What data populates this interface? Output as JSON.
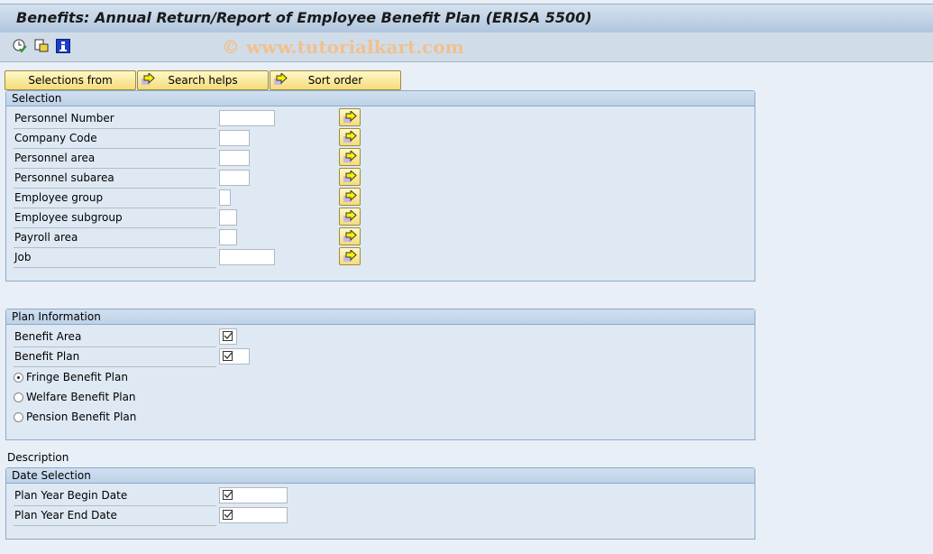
{
  "window": {
    "title": "Benefits: Annual Return/Report of Employee Benefit Plan (ERISA 5500)",
    "watermark": "© www.tutorialkart.com"
  },
  "toolbar": {
    "icons": [
      "execute-clock-icon",
      "get-variant-icon",
      "info-icon"
    ]
  },
  "buttons": {
    "selections_from": "Selections from",
    "search_helps": "Search helps",
    "sort_order": "Sort order"
  },
  "selection": {
    "title": "Selection",
    "fields": [
      {
        "label": "Personnel Number",
        "value": ""
      },
      {
        "label": "Company Code",
        "value": ""
      },
      {
        "label": "Personnel area",
        "value": ""
      },
      {
        "label": "Personnel subarea",
        "value": ""
      },
      {
        "label": "Employee group",
        "value": ""
      },
      {
        "label": "Employee subgroup",
        "value": ""
      },
      {
        "label": "Payroll area",
        "value": ""
      },
      {
        "label": "Job",
        "value": ""
      }
    ]
  },
  "plan_info": {
    "title": "Plan Information",
    "fields": [
      {
        "label": "Benefit Area",
        "value": "required"
      },
      {
        "label": "Benefit Plan",
        "value": "required"
      }
    ],
    "radios": [
      {
        "label": "Fringe Benefit Plan",
        "selected": true
      },
      {
        "label": "Welfare Benefit Plan",
        "selected": false
      },
      {
        "label": "Pension Benefit Plan",
        "selected": false
      }
    ]
  },
  "description_label": "Description",
  "date_selection": {
    "title": "Date Selection",
    "fields": [
      {
        "label": "Plan Year Begin Date",
        "value": "required"
      },
      {
        "label": "Plan Year End Date",
        "value": "required"
      }
    ]
  }
}
